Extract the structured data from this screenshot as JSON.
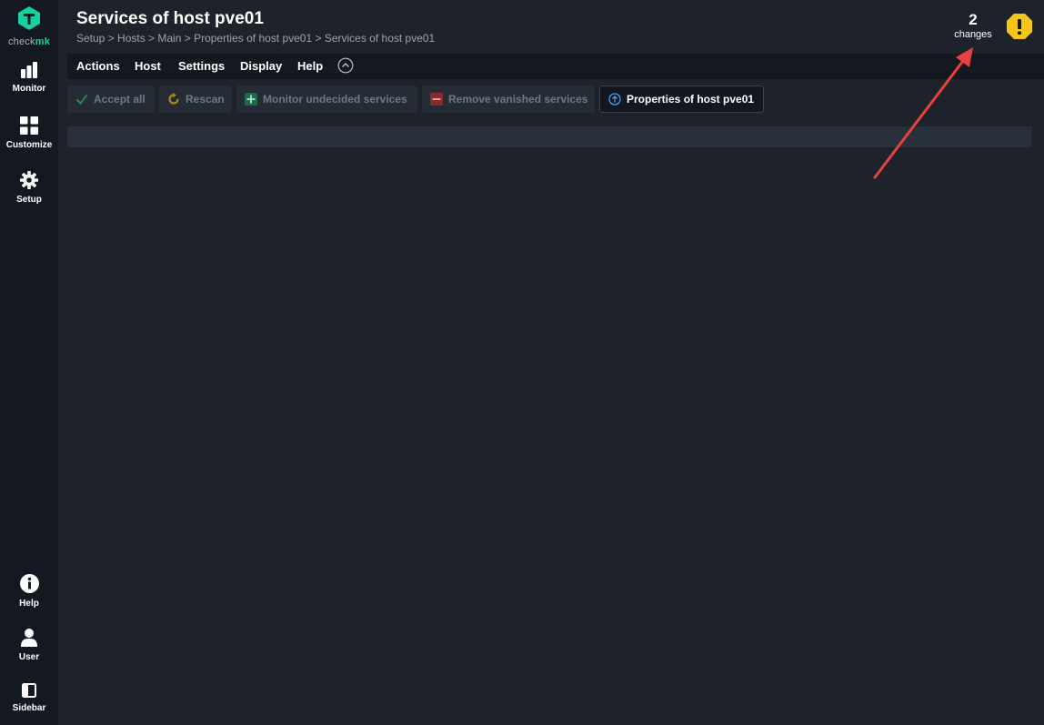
{
  "app": {
    "logo_text_a": "check",
    "logo_text_b": "mk"
  },
  "sidebar": {
    "top_items": [
      {
        "label": "Monitor",
        "icon": "bar-chart-icon"
      },
      {
        "label": "Customize",
        "icon": "grid-icon"
      },
      {
        "label": "Setup",
        "icon": "gear-icon"
      }
    ],
    "bottom_items": [
      {
        "label": "Help",
        "icon": "info-icon"
      },
      {
        "label": "User",
        "icon": "user-icon"
      },
      {
        "label": "Sidebar",
        "icon": "sidebar-toggle-icon"
      }
    ]
  },
  "header": {
    "title": "Services of host pve01",
    "breadcrumb": "Setup > Hosts > Main > Properties of host pve01 > Services of host pve01",
    "changes_count": "2",
    "changes_label": "changes"
  },
  "menubar": {
    "items": [
      "Actions",
      "Host",
      "Settings",
      "Display",
      "Help"
    ]
  },
  "toolbar": {
    "buttons": [
      {
        "label": "Accept all",
        "icon": "checkmark-icon",
        "enabled": false
      },
      {
        "label": "Rescan",
        "icon": "refresh-icon",
        "enabled": false
      },
      {
        "label": "Monitor undecided services",
        "icon": "plus-icon",
        "enabled": false
      },
      {
        "label": "Remove vanished services",
        "icon": "minus-icon",
        "enabled": false
      },
      {
        "label": "Properties of host pve01",
        "icon": "arrow-up-circle-icon",
        "enabled": true
      }
    ]
  },
  "colors": {
    "brand": "#15d1a0",
    "warning": "#f5c518",
    "annotation_arrow": "#e8423f",
    "background": "#1e232b",
    "sidebar": "#141820"
  }
}
